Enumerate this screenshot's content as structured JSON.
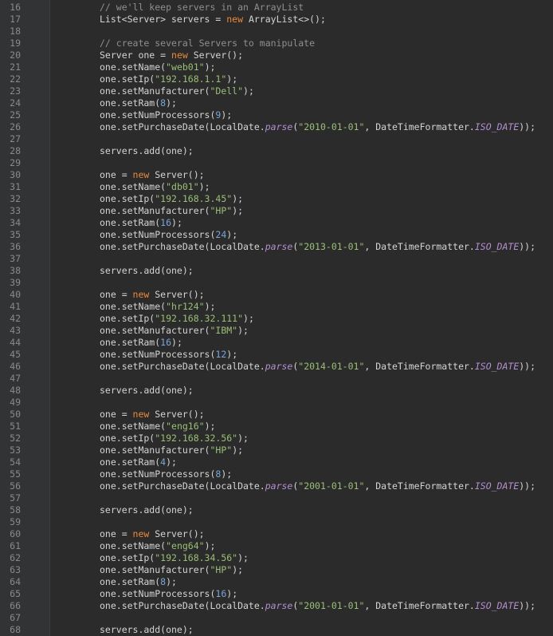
{
  "editor": {
    "colors": {
      "background": "#2b2b2b",
      "gutter": "#313335",
      "line_number": "#8a8a8a",
      "plain": "#d4d4d4",
      "comment": "#8f8f8f",
      "keyword": "#e8893c",
      "string": "#9bbf76",
      "number": "#7aa6da",
      "static_field": "#b38fd1"
    },
    "lines": [
      {
        "n": "16",
        "tokens": [
          {
            "t": "// we'll keep servers in an ArrayList",
            "c": "comment"
          }
        ]
      },
      {
        "n": "17",
        "tokens": [
          {
            "t": "List<Server> servers = ",
            "c": "plain"
          },
          {
            "t": "new",
            "c": "keyword"
          },
          {
            "t": " ArrayList<>();",
            "c": "plain"
          }
        ]
      },
      {
        "n": "18",
        "tokens": []
      },
      {
        "n": "19",
        "tokens": [
          {
            "t": "// create several Servers to manipulate",
            "c": "comment"
          }
        ]
      },
      {
        "n": "20",
        "tokens": [
          {
            "t": "Server one = ",
            "c": "plain"
          },
          {
            "t": "new",
            "c": "keyword"
          },
          {
            "t": " Server();",
            "c": "plain"
          }
        ]
      },
      {
        "n": "21",
        "tokens": [
          {
            "t": "one.setName(",
            "c": "plain"
          },
          {
            "t": "\"web01\"",
            "c": "string"
          },
          {
            "t": ");",
            "c": "plain"
          }
        ]
      },
      {
        "n": "22",
        "tokens": [
          {
            "t": "one.setIp(",
            "c": "plain"
          },
          {
            "t": "\"192.168.1.1\"",
            "c": "string"
          },
          {
            "t": ");",
            "c": "plain"
          }
        ]
      },
      {
        "n": "23",
        "tokens": [
          {
            "t": "one.setManufacturer(",
            "c": "plain"
          },
          {
            "t": "\"Dell\"",
            "c": "string"
          },
          {
            "t": ");",
            "c": "plain"
          }
        ]
      },
      {
        "n": "24",
        "tokens": [
          {
            "t": "one.setRam(",
            "c": "plain"
          },
          {
            "t": "8",
            "c": "number"
          },
          {
            "t": ");",
            "c": "plain"
          }
        ]
      },
      {
        "n": "25",
        "tokens": [
          {
            "t": "one.setNumProcessors(",
            "c": "plain"
          },
          {
            "t": "9",
            "c": "number"
          },
          {
            "t": ");",
            "c": "plain"
          }
        ]
      },
      {
        "n": "26",
        "tokens": [
          {
            "t": "one.setPurchaseDate(LocalDate.",
            "c": "plain"
          },
          {
            "t": "parse",
            "c": "static"
          },
          {
            "t": "(",
            "c": "plain"
          },
          {
            "t": "\"2010-01-01\"",
            "c": "string"
          },
          {
            "t": ", DateTimeFormatter.",
            "c": "plain"
          },
          {
            "t": "ISO_DATE",
            "c": "static"
          },
          {
            "t": "));",
            "c": "plain"
          }
        ]
      },
      {
        "n": "27",
        "tokens": []
      },
      {
        "n": "28",
        "tokens": [
          {
            "t": "servers.add(one);",
            "c": "plain"
          }
        ]
      },
      {
        "n": "29",
        "tokens": []
      },
      {
        "n": "30",
        "tokens": [
          {
            "t": "one = ",
            "c": "plain"
          },
          {
            "t": "new",
            "c": "keyword"
          },
          {
            "t": " Server();",
            "c": "plain"
          }
        ]
      },
      {
        "n": "31",
        "tokens": [
          {
            "t": "one.setName(",
            "c": "plain"
          },
          {
            "t": "\"db01\"",
            "c": "string"
          },
          {
            "t": ");",
            "c": "plain"
          }
        ]
      },
      {
        "n": "32",
        "tokens": [
          {
            "t": "one.setIp(",
            "c": "plain"
          },
          {
            "t": "\"192.168.3.45\"",
            "c": "string"
          },
          {
            "t": ");",
            "c": "plain"
          }
        ]
      },
      {
        "n": "33",
        "tokens": [
          {
            "t": "one.setManufacturer(",
            "c": "plain"
          },
          {
            "t": "\"HP\"",
            "c": "string"
          },
          {
            "t": ");",
            "c": "plain"
          }
        ]
      },
      {
        "n": "34",
        "tokens": [
          {
            "t": "one.setRam(",
            "c": "plain"
          },
          {
            "t": "16",
            "c": "number"
          },
          {
            "t": ");",
            "c": "plain"
          }
        ]
      },
      {
        "n": "35",
        "tokens": [
          {
            "t": "one.setNumProcessors(",
            "c": "plain"
          },
          {
            "t": "24",
            "c": "number"
          },
          {
            "t": ");",
            "c": "plain"
          }
        ]
      },
      {
        "n": "36",
        "tokens": [
          {
            "t": "one.setPurchaseDate(LocalDate.",
            "c": "plain"
          },
          {
            "t": "parse",
            "c": "static"
          },
          {
            "t": "(",
            "c": "plain"
          },
          {
            "t": "\"2013-01-01\"",
            "c": "string"
          },
          {
            "t": ", DateTimeFormatter.",
            "c": "plain"
          },
          {
            "t": "ISO_DATE",
            "c": "static"
          },
          {
            "t": "));",
            "c": "plain"
          }
        ]
      },
      {
        "n": "37",
        "tokens": []
      },
      {
        "n": "38",
        "tokens": [
          {
            "t": "servers.add(one);",
            "c": "plain"
          }
        ]
      },
      {
        "n": "39",
        "tokens": []
      },
      {
        "n": "40",
        "tokens": [
          {
            "t": "one = ",
            "c": "plain"
          },
          {
            "t": "new",
            "c": "keyword"
          },
          {
            "t": " Server();",
            "c": "plain"
          }
        ]
      },
      {
        "n": "41",
        "tokens": [
          {
            "t": "one.setName(",
            "c": "plain"
          },
          {
            "t": "\"hr124\"",
            "c": "string"
          },
          {
            "t": ");",
            "c": "plain"
          }
        ]
      },
      {
        "n": "42",
        "tokens": [
          {
            "t": "one.setIp(",
            "c": "plain"
          },
          {
            "t": "\"192.168.32.111\"",
            "c": "string"
          },
          {
            "t": ");",
            "c": "plain"
          }
        ]
      },
      {
        "n": "43",
        "tokens": [
          {
            "t": "one.setManufacturer(",
            "c": "plain"
          },
          {
            "t": "\"IBM\"",
            "c": "string"
          },
          {
            "t": ");",
            "c": "plain"
          }
        ]
      },
      {
        "n": "44",
        "tokens": [
          {
            "t": "one.setRam(",
            "c": "plain"
          },
          {
            "t": "16",
            "c": "number"
          },
          {
            "t": ");",
            "c": "plain"
          }
        ]
      },
      {
        "n": "45",
        "tokens": [
          {
            "t": "one.setNumProcessors(",
            "c": "plain"
          },
          {
            "t": "12",
            "c": "number"
          },
          {
            "t": ");",
            "c": "plain"
          }
        ]
      },
      {
        "n": "46",
        "tokens": [
          {
            "t": "one.setPurchaseDate(LocalDate.",
            "c": "plain"
          },
          {
            "t": "parse",
            "c": "static"
          },
          {
            "t": "(",
            "c": "plain"
          },
          {
            "t": "\"2014-01-01\"",
            "c": "string"
          },
          {
            "t": ", DateTimeFormatter.",
            "c": "plain"
          },
          {
            "t": "ISO_DATE",
            "c": "static"
          },
          {
            "t": "));",
            "c": "plain"
          }
        ]
      },
      {
        "n": "47",
        "tokens": []
      },
      {
        "n": "48",
        "tokens": [
          {
            "t": "servers.add(one);",
            "c": "plain"
          }
        ]
      },
      {
        "n": "49",
        "tokens": []
      },
      {
        "n": "50",
        "tokens": [
          {
            "t": "one = ",
            "c": "plain"
          },
          {
            "t": "new",
            "c": "keyword"
          },
          {
            "t": " Server();",
            "c": "plain"
          }
        ]
      },
      {
        "n": "51",
        "tokens": [
          {
            "t": "one.setName(",
            "c": "plain"
          },
          {
            "t": "\"eng16\"",
            "c": "string"
          },
          {
            "t": ");",
            "c": "plain"
          }
        ]
      },
      {
        "n": "52",
        "tokens": [
          {
            "t": "one.setIp(",
            "c": "plain"
          },
          {
            "t": "\"192.168.32.56\"",
            "c": "string"
          },
          {
            "t": ");",
            "c": "plain"
          }
        ]
      },
      {
        "n": "53",
        "tokens": [
          {
            "t": "one.setManufacturer(",
            "c": "plain"
          },
          {
            "t": "\"HP\"",
            "c": "string"
          },
          {
            "t": ");",
            "c": "plain"
          }
        ]
      },
      {
        "n": "54",
        "tokens": [
          {
            "t": "one.setRam(",
            "c": "plain"
          },
          {
            "t": "4",
            "c": "number"
          },
          {
            "t": ");",
            "c": "plain"
          }
        ]
      },
      {
        "n": "55",
        "tokens": [
          {
            "t": "one.setNumProcessors(",
            "c": "plain"
          },
          {
            "t": "8",
            "c": "number"
          },
          {
            "t": ");",
            "c": "plain"
          }
        ]
      },
      {
        "n": "56",
        "tokens": [
          {
            "t": "one.setPurchaseDate(LocalDate.",
            "c": "plain"
          },
          {
            "t": "parse",
            "c": "static"
          },
          {
            "t": "(",
            "c": "plain"
          },
          {
            "t": "\"2001-01-01\"",
            "c": "string"
          },
          {
            "t": ", DateTimeFormatter.",
            "c": "plain"
          },
          {
            "t": "ISO_DATE",
            "c": "static"
          },
          {
            "t": "));",
            "c": "plain"
          }
        ]
      },
      {
        "n": "57",
        "tokens": []
      },
      {
        "n": "58",
        "tokens": [
          {
            "t": "servers.add(one);",
            "c": "plain"
          }
        ]
      },
      {
        "n": "59",
        "tokens": []
      },
      {
        "n": "60",
        "tokens": [
          {
            "t": "one = ",
            "c": "plain"
          },
          {
            "t": "new",
            "c": "keyword"
          },
          {
            "t": " Server();",
            "c": "plain"
          }
        ]
      },
      {
        "n": "61",
        "tokens": [
          {
            "t": "one.setName(",
            "c": "plain"
          },
          {
            "t": "\"eng64\"",
            "c": "string"
          },
          {
            "t": ");",
            "c": "plain"
          }
        ]
      },
      {
        "n": "62",
        "tokens": [
          {
            "t": "one.setIp(",
            "c": "plain"
          },
          {
            "t": "\"192.168.34.56\"",
            "c": "string"
          },
          {
            "t": ");",
            "c": "plain"
          }
        ]
      },
      {
        "n": "63",
        "tokens": [
          {
            "t": "one.setManufacturer(",
            "c": "plain"
          },
          {
            "t": "\"HP\"",
            "c": "string"
          },
          {
            "t": ");",
            "c": "plain"
          }
        ]
      },
      {
        "n": "64",
        "tokens": [
          {
            "t": "one.setRam(",
            "c": "plain"
          },
          {
            "t": "8",
            "c": "number"
          },
          {
            "t": ");",
            "c": "plain"
          }
        ]
      },
      {
        "n": "65",
        "tokens": [
          {
            "t": "one.setNumProcessors(",
            "c": "plain"
          },
          {
            "t": "16",
            "c": "number"
          },
          {
            "t": ");",
            "c": "plain"
          }
        ]
      },
      {
        "n": "66",
        "tokens": [
          {
            "t": "one.setPurchaseDate(LocalDate.",
            "c": "plain"
          },
          {
            "t": "parse",
            "c": "static"
          },
          {
            "t": "(",
            "c": "plain"
          },
          {
            "t": "\"2001-01-01\"",
            "c": "string"
          },
          {
            "t": ", DateTimeFormatter.",
            "c": "plain"
          },
          {
            "t": "ISO_DATE",
            "c": "static"
          },
          {
            "t": "));",
            "c": "plain"
          }
        ]
      },
      {
        "n": "67",
        "tokens": []
      },
      {
        "n": "68",
        "tokens": [
          {
            "t": "servers.add(one);",
            "c": "plain"
          }
        ]
      }
    ]
  }
}
